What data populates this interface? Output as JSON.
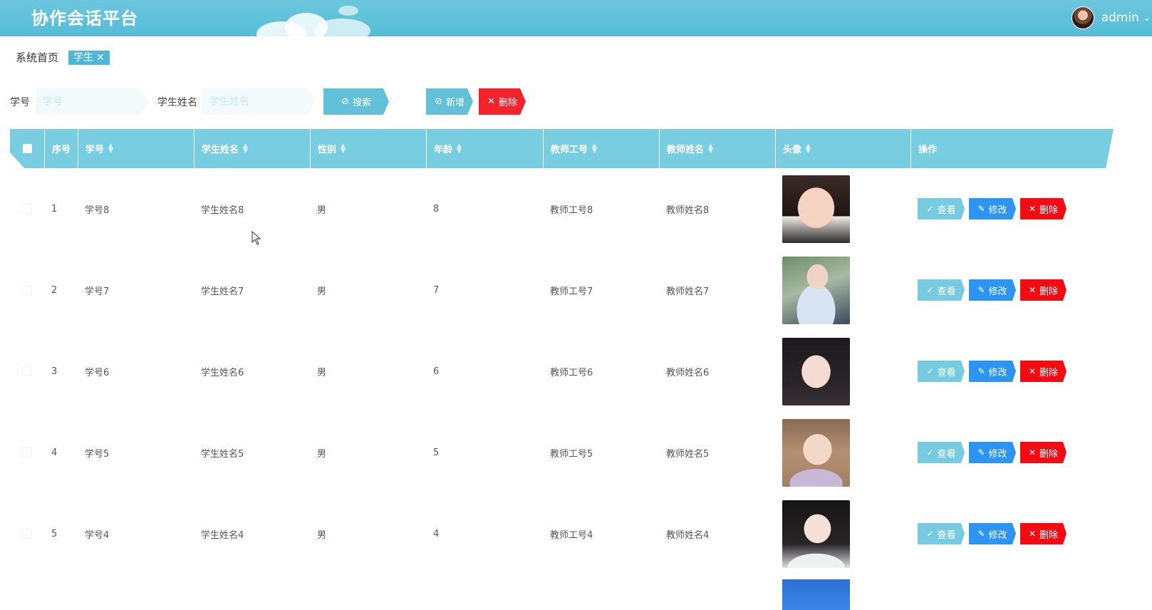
{
  "header": {
    "app_title": "协作会话平台",
    "user_name": "admin",
    "caret": "⌄",
    "bg_color": "#5abfda"
  },
  "breadcrumb": {
    "home": "系统首页",
    "current_tab": "学生",
    "close": "✕"
  },
  "search": {
    "field1_label": "学号",
    "field1_placeholder": "学号",
    "field1_value": "",
    "field2_label": "学生姓名",
    "field2_placeholder": "学生姓名",
    "field2_value": "",
    "search_button": "搜索",
    "add_button": "新增",
    "delete_button": "删除",
    "search_icon": "check-circle-icon",
    "add_icon": "check-circle-icon",
    "delete_icon": "close-icon"
  },
  "table": {
    "columns": [
      "序号",
      "学号",
      "学生姓名",
      "性别",
      "年龄",
      "教师工号",
      "教师姓名",
      "头像",
      "操作"
    ],
    "rows": [
      {
        "index": "1",
        "student_no": "学号8",
        "student_name": "学生姓名8",
        "gender": "男",
        "age": "8",
        "teacher_no": "教师工号8",
        "teacher_name": "教师姓名8"
      },
      {
        "index": "2",
        "student_no": "学号7",
        "student_name": "学生姓名7",
        "gender": "男",
        "age": "7",
        "teacher_no": "教师工号7",
        "teacher_name": "教师姓名7"
      },
      {
        "index": "3",
        "student_no": "学号6",
        "student_name": "学生姓名6",
        "gender": "男",
        "age": "6",
        "teacher_no": "教师工号6",
        "teacher_name": "教师姓名6"
      },
      {
        "index": "4",
        "student_no": "学号5",
        "student_name": "学生姓名5",
        "gender": "男",
        "age": "5",
        "teacher_no": "教师工号5",
        "teacher_name": "教师姓名5"
      },
      {
        "index": "5",
        "student_no": "学号4",
        "student_name": "学生姓名4",
        "gender": "男",
        "age": "4",
        "teacher_no": "教师工号4",
        "teacher_name": "教师姓名4"
      }
    ],
    "actions": {
      "view": "查看",
      "edit": "修改",
      "delete": "删除"
    }
  },
  "colors": {
    "accent": "#62c1d9",
    "edit": "#2d94f2",
    "danger": "#f30b14"
  }
}
